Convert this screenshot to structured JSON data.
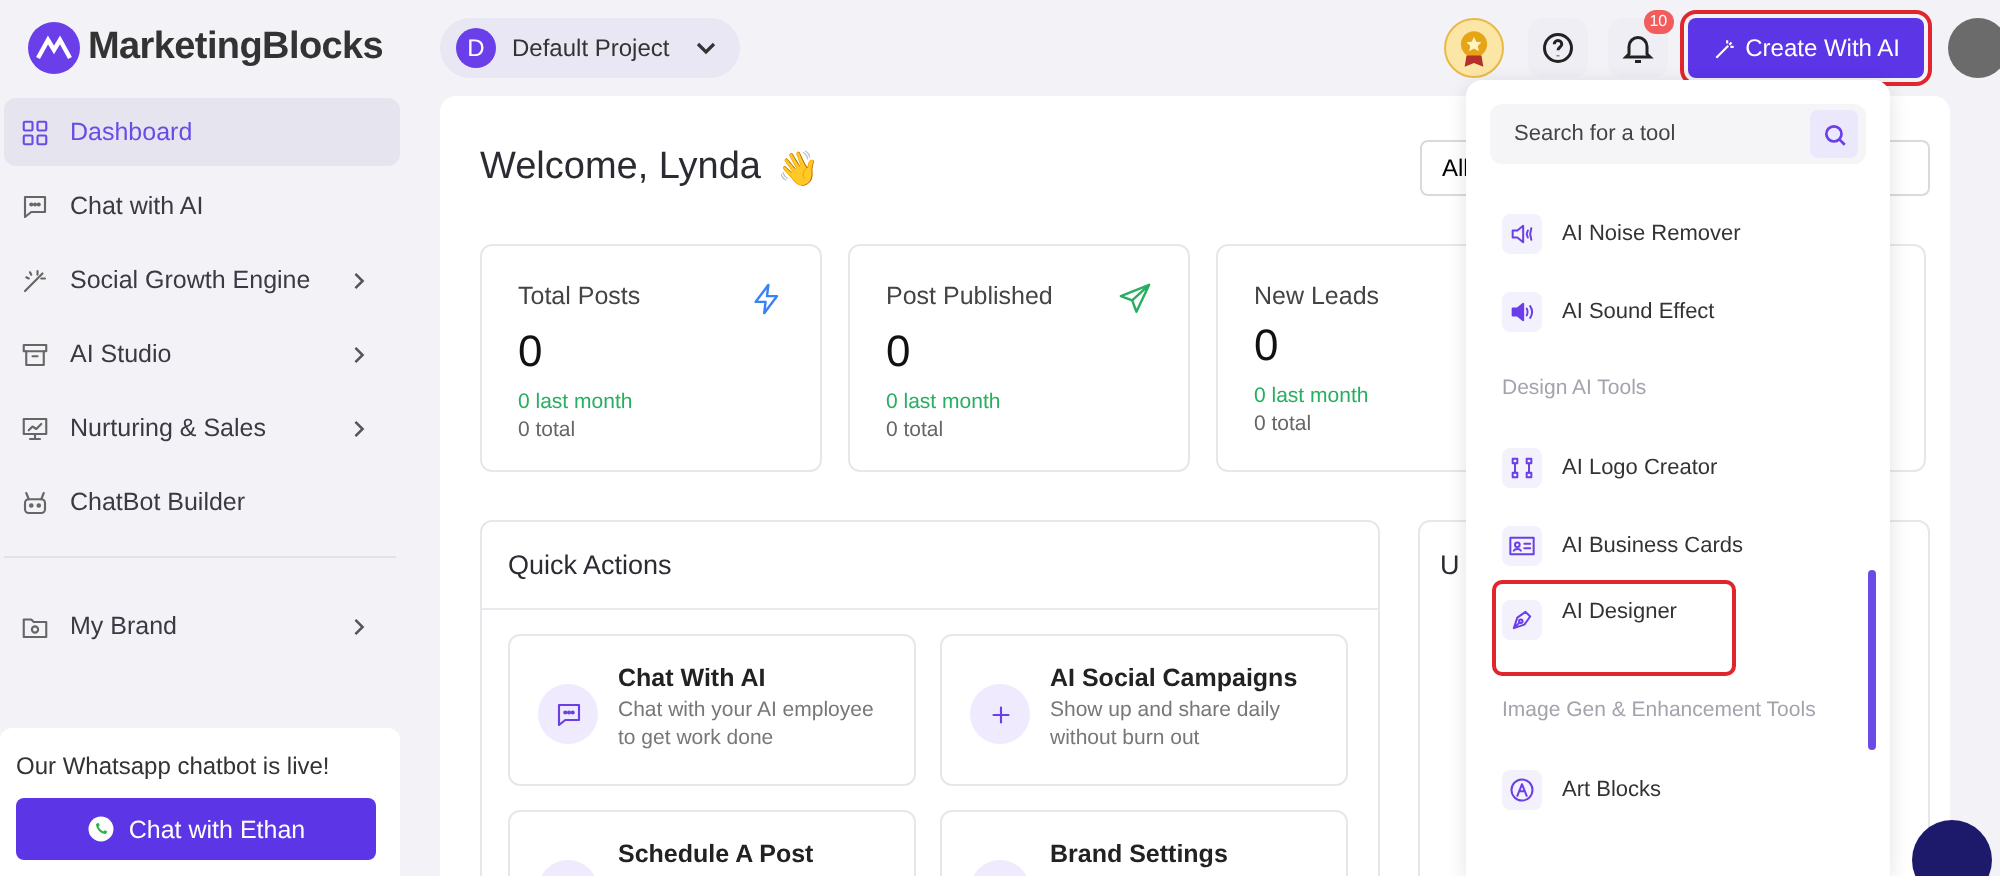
{
  "header": {
    "logo": "MarketingBlocks",
    "project": {
      "initial": "D",
      "name": "Default Project"
    },
    "notifications": "10",
    "create_button": {
      "label": "Create With AI",
      "highlighted": true
    }
  },
  "sidebar": {
    "items": [
      {
        "label": "Dashboard",
        "selected": true,
        "submenu": false
      },
      {
        "label": "Chat with AI",
        "selected": false,
        "submenu": false
      },
      {
        "label": "Social Growth Engine",
        "selected": false,
        "submenu": true
      },
      {
        "label": "AI Studio",
        "selected": false,
        "submenu": true
      },
      {
        "label": "Nurturing & Sales",
        "selected": false,
        "submenu": true
      },
      {
        "label": "ChatBot Builder",
        "selected": false,
        "submenu": false
      }
    ],
    "bottom_items": [
      {
        "label": "My Brand",
        "selected": false,
        "submenu": true
      }
    ],
    "promo": {
      "text": "Our Whatsapp chatbot is live!",
      "button": "Chat with Ethan"
    }
  },
  "main": {
    "welcome": "Welcome,  Lynda",
    "emoji": "👋",
    "filter": "All",
    "stats": [
      {
        "title": "Total Posts",
        "value": "0",
        "last_month": "0 last month",
        "total": "0 total"
      },
      {
        "title": "Post Published",
        "value": "0",
        "last_month": "0 last month",
        "total": "0 total"
      },
      {
        "title": "New Leads",
        "value": "0",
        "last_month": "0 last month",
        "total": "0 total"
      }
    ],
    "quick_actions": {
      "title": "Quick Actions",
      "items": [
        {
          "title": "Chat With AI",
          "desc": "Chat with your AI employee to get work done"
        },
        {
          "title": "AI Social Campaigns",
          "desc": "Show up and share daily without burn out"
        },
        {
          "title": "Schedule A Post"
        },
        {
          "title": "Brand Settings"
        }
      ]
    },
    "side_card_title": "U"
  },
  "tools_menu": {
    "search": {
      "placeholder": "Search for a tool"
    },
    "entries": [
      {
        "kind": "tool",
        "label": "AI Noise Remover",
        "highlighted": false
      },
      {
        "kind": "tool",
        "label": "AI Sound Effect",
        "highlighted": false
      },
      {
        "kind": "heading",
        "label": "Design AI Tools"
      },
      {
        "kind": "tool",
        "label": "AI Logo Creator",
        "highlighted": false
      },
      {
        "kind": "tool",
        "label": "AI Business Cards",
        "highlighted": false
      },
      {
        "kind": "tool",
        "label": "AI Designer",
        "highlighted": true
      },
      {
        "kind": "heading",
        "label": "Image Gen & Enhancement Tools"
      },
      {
        "kind": "tool",
        "label": "Art Blocks",
        "highlighted": false
      }
    ]
  }
}
